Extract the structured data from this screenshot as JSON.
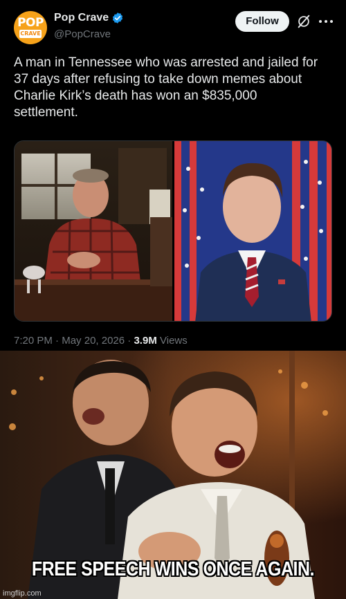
{
  "account": {
    "display_name": "Pop Crave",
    "handle": "@PopCrave",
    "avatar_text_top": "POP",
    "avatar_text_bottom": "CRAVE",
    "verified": true
  },
  "actions": {
    "follow_label": "Follow",
    "grok_icon": "grok-icon",
    "more_icon": "more-icon"
  },
  "tweet": {
    "lines": [
      "A man in Tennessee who was arrested and jailed for",
      "37 days after refusing to take down memes about",
      "Charlie Kirk’s death has won an $835,000",
      "settlement."
    ],
    "time": "7:20 PM",
    "sep1": "·",
    "date": "May 20, 2026",
    "sep2": "·",
    "views_count": "3.9M",
    "views_label": "Views"
  },
  "meme": {
    "caption": "FREE SPEECH WINS ONCE AGAIN.",
    "watermark": "imgflip.com"
  },
  "colors": {
    "background": "#000000",
    "text_primary": "#e7e9ea",
    "text_secondary": "#71767b",
    "verified_blue": "#1d9bf0",
    "avatar_orange": "#f6a21a"
  }
}
